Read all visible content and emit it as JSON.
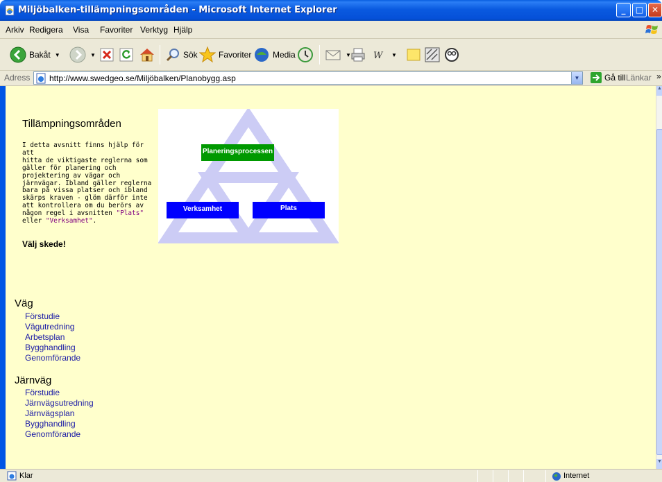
{
  "window": {
    "title": "Miljöbalken-tillämpningsområden - Microsoft Internet Explorer",
    "minimize": "_",
    "maximize": "□",
    "close": "✕"
  },
  "menu": {
    "items": [
      "Arkiv",
      "Redigera",
      "Visa",
      "Favoriter",
      "Verktyg",
      "Hjälp"
    ]
  },
  "toolbar": {
    "back_label": "Bakåt",
    "search_label": "Sök",
    "favorites_label": "Favoriter",
    "media_label": "Media"
  },
  "address": {
    "label": "Adress",
    "url": "http://www.swedgeo.se/Miljöbalken/Planobygg.asp",
    "go_label": "Gå till",
    "links_label": "Länkar",
    "links_chevron": "»"
  },
  "page": {
    "heading": "Tillämpningsområden",
    "intro_lines": [
      "I detta avsnitt finns hjälp för att",
      "hitta de viktigaste reglerna som",
      "gäller för planering och",
      "projektering av vägar och",
      "järnvägar. Ibland gäller reglerna",
      "bara på vissa platser och ibland",
      "skärps kraven - glöm därför inte",
      "att kontrollera om du berörs av",
      "någon regel i avsnitten"
    ],
    "intro_link_plats": "\"Plats\"",
    "intro_eller": "eller",
    "intro_link_verksamhet": "\"Verksamhet\"",
    "intro_end": ".",
    "choose_phase": "Välj skede!",
    "diagram": {
      "planning": "Planeringsprocessen",
      "activity": "Verksamhet",
      "place": "Plats",
      "triangle_color": "#ccccf5",
      "green": "#009900",
      "blue": "#0000ff"
    },
    "road": {
      "title": "Väg",
      "links": [
        "Förstudie",
        "Vägutredning",
        "Arbetsplan",
        "Bygghandling",
        "Genomförande"
      ]
    },
    "rail": {
      "title": "Järnväg",
      "links": [
        "Förstudie",
        "Järnvägsutredning",
        "Järnvägsplan",
        "Bygghandling",
        "Genomförande"
      ]
    }
  },
  "status": {
    "text": "Klar",
    "zone": "Internet"
  }
}
